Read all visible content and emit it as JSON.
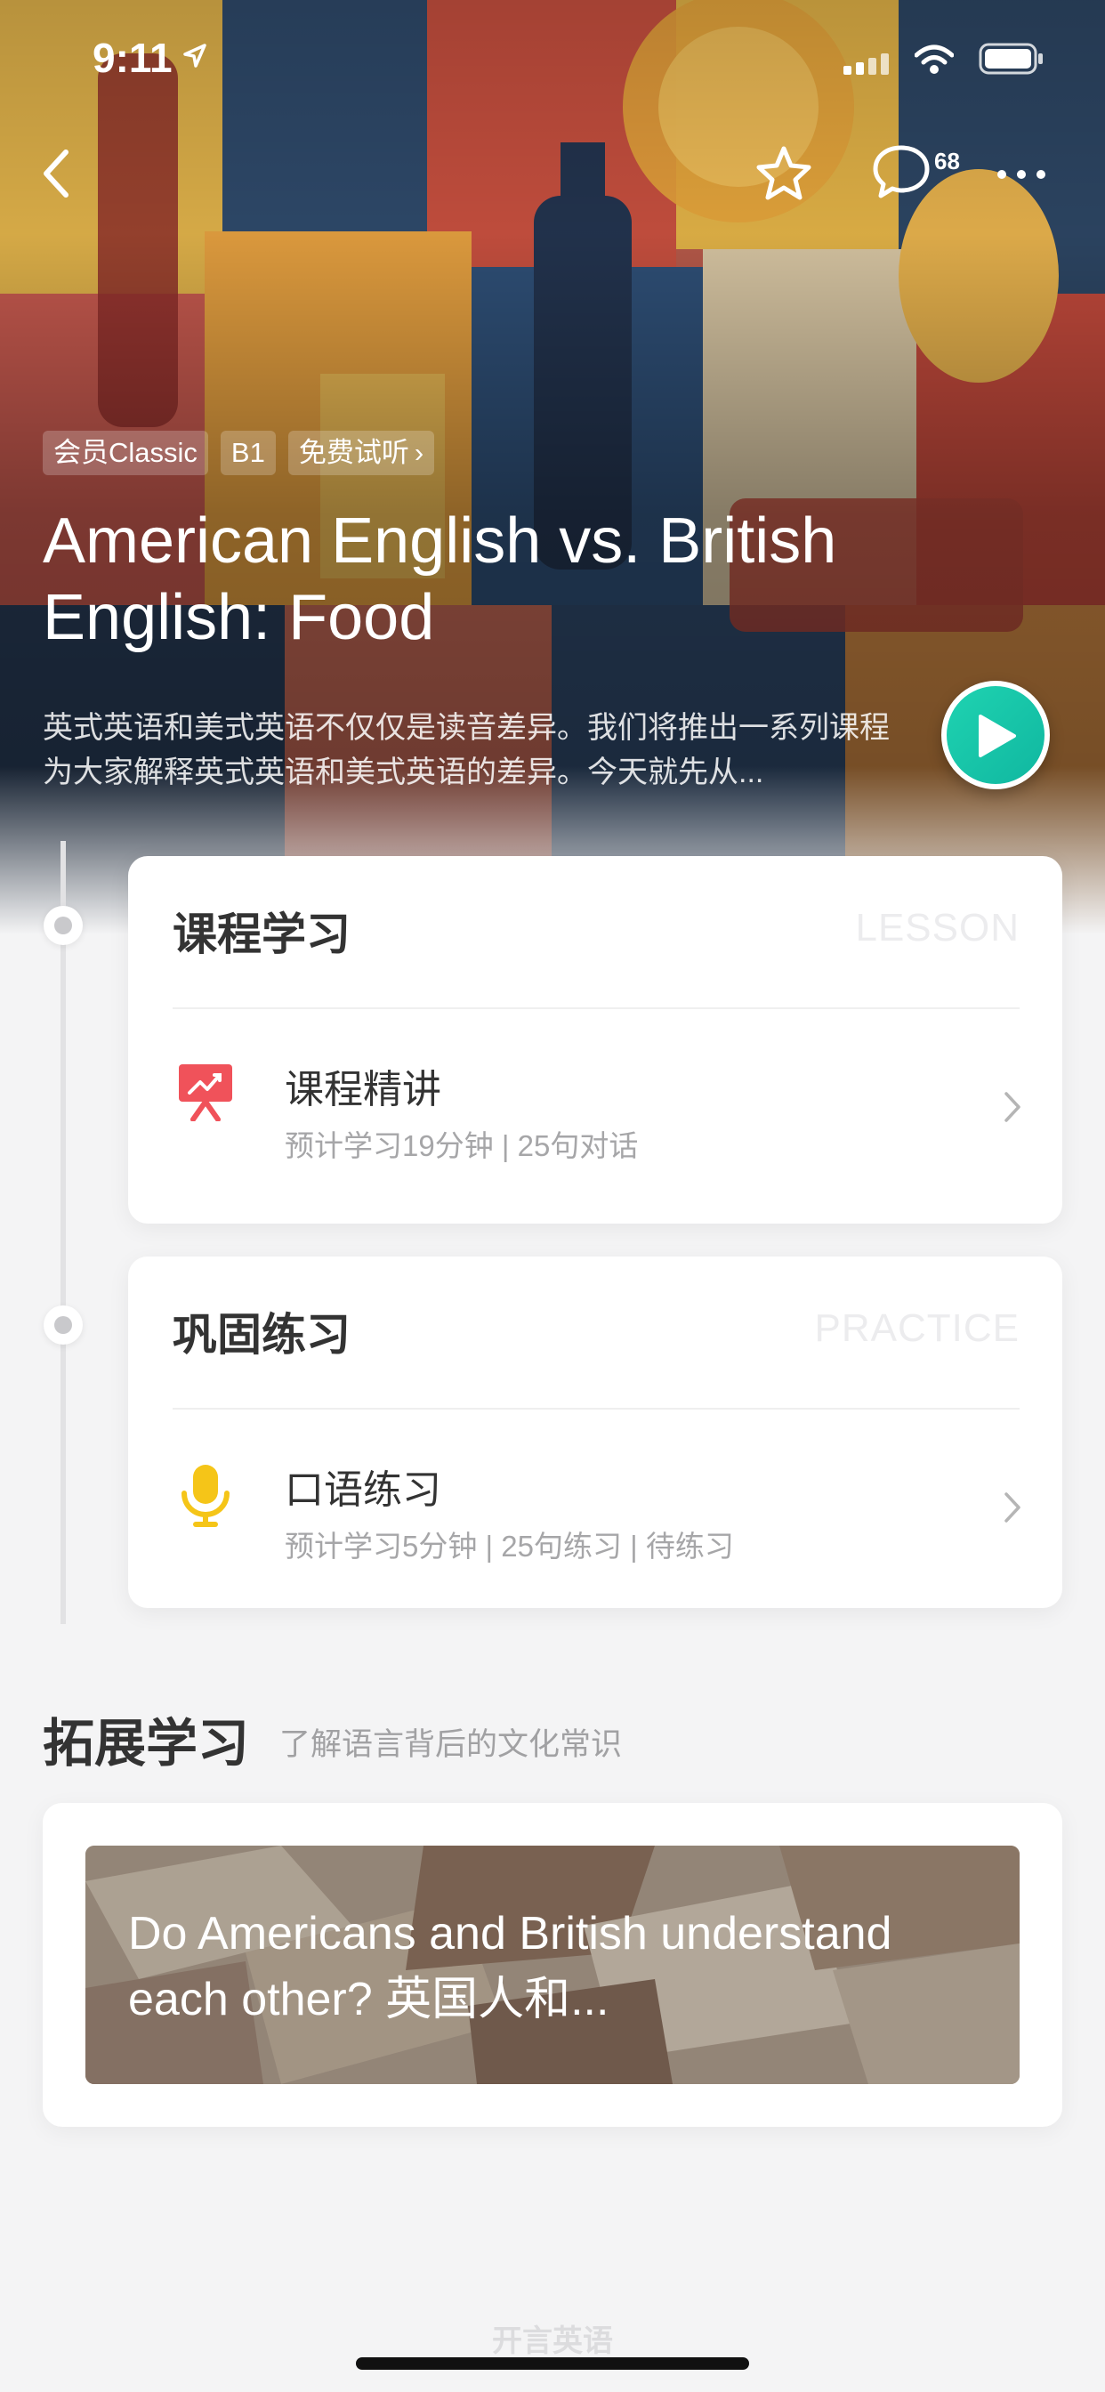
{
  "status_bar": {
    "time": "9:11"
  },
  "nav": {
    "comment_count": "68"
  },
  "hero": {
    "tags": [
      "会员Classic",
      "B1",
      "免费试听"
    ],
    "title": "American English vs. British English: Food",
    "description": "英式英语和美式英语不仅仅是读音差异。我们将推出一系列课程为大家解释英式英语和美式英语的差异。今天就先从..."
  },
  "lesson": {
    "heading": "课程学习",
    "heading_en": "LESSON",
    "item_title": "课程精讲",
    "item_sub": "预计学习19分钟 | 25句对话",
    "icon": "presentation-chart-icon"
  },
  "practice": {
    "heading": "巩固练习",
    "heading_en": "PRACTICE",
    "item_title": "口语练习",
    "item_sub": "预计学习5分钟 | 25句练习 | 待练习",
    "icon": "microphone-icon"
  },
  "extended": {
    "title": "拓展学习",
    "subtitle": "了解语言背后的文化常识",
    "article_title": "Do Americans and British understand each other?  英国人和..."
  },
  "footer": {
    "logo_text": "开言英语"
  },
  "colors": {
    "accent": "#15C3A6",
    "lesson_icon": "#F0525A",
    "practice_icon": "#F5C518"
  }
}
